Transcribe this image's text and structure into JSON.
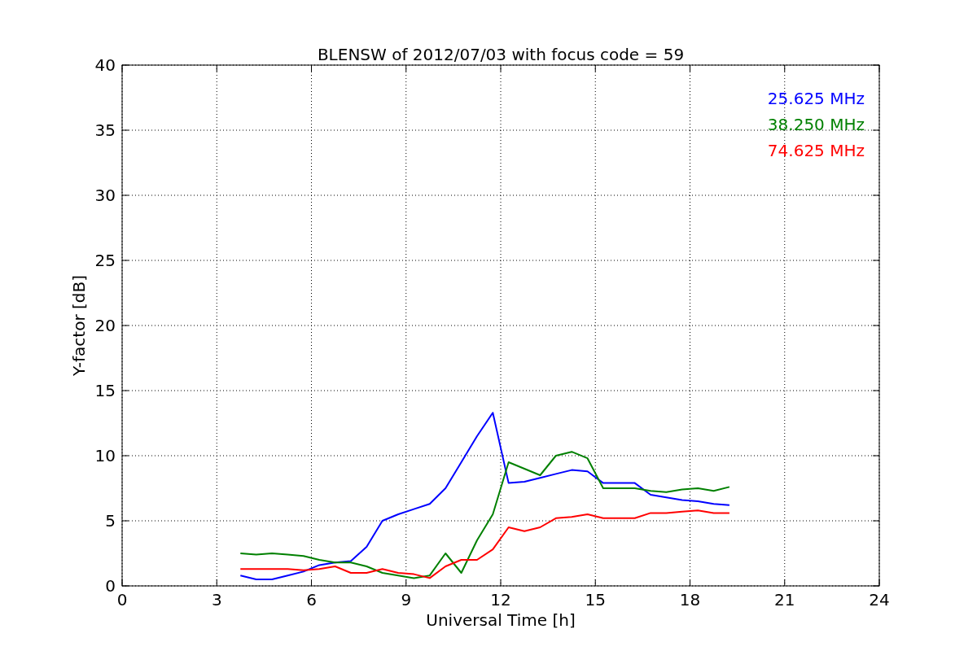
{
  "figure": {
    "chart_data": {
      "type": "line",
      "title": "BLENSW of 2012/07/03 with focus code = 59",
      "xlabel": "Universal Time [h]",
      "ylabel": "Y-factor [dB]",
      "xlim": [
        0,
        24
      ],
      "ylim": [
        0,
        40
      ],
      "xticks": [
        0,
        3,
        6,
        9,
        12,
        15,
        18,
        21,
        24
      ],
      "yticks": [
        0,
        5,
        10,
        15,
        20,
        25,
        30,
        35,
        40
      ],
      "grid": true,
      "x": [
        3.75,
        4.25,
        4.75,
        5.25,
        5.75,
        6.25,
        6.75,
        7.25,
        7.75,
        8.25,
        8.75,
        9.25,
        9.75,
        10.25,
        10.75,
        11.25,
        11.75,
        12.25,
        12.75,
        13.25,
        13.75,
        14.25,
        14.75,
        15.25,
        15.75,
        16.25,
        16.75,
        17.25,
        17.75,
        18.25,
        18.75,
        19.25
      ],
      "series": [
        {
          "name": "25.625 MHz",
          "color": "#0000ff",
          "values": [
            0.8,
            0.5,
            0.5,
            0.8,
            1.1,
            1.6,
            1.8,
            1.9,
            3.0,
            5.0,
            5.5,
            5.9,
            6.3,
            7.5,
            9.5,
            11.5,
            13.3,
            7.9,
            8.0,
            8.3,
            8.6,
            8.9,
            8.8,
            7.9,
            7.9,
            7.9,
            7.0,
            6.8,
            6.6,
            6.5,
            6.3,
            6.2
          ]
        },
        {
          "name": "38.250 MHz",
          "color": "#008000",
          "values": [
            2.5,
            2.4,
            2.5,
            2.4,
            2.3,
            2.0,
            1.8,
            1.8,
            1.5,
            1.0,
            0.8,
            0.6,
            0.8,
            2.5,
            1.0,
            3.5,
            5.5,
            9.5,
            9.0,
            8.5,
            10.0,
            10.3,
            9.8,
            7.5,
            7.5,
            7.5,
            7.3,
            7.2,
            7.4,
            7.5,
            7.3,
            7.6
          ]
        },
        {
          "name": "74.625 MHz",
          "color": "#ff0000",
          "values": [
            1.3,
            1.3,
            1.3,
            1.3,
            1.2,
            1.3,
            1.5,
            1.0,
            1.0,
            1.3,
            1.0,
            0.9,
            0.6,
            1.5,
            2.0,
            2.0,
            2.8,
            4.5,
            4.2,
            4.5,
            5.2,
            5.3,
            5.5,
            5.2,
            5.2,
            5.2,
            5.6,
            5.6,
            5.7,
            5.8,
            5.6,
            5.6
          ]
        }
      ]
    }
  }
}
